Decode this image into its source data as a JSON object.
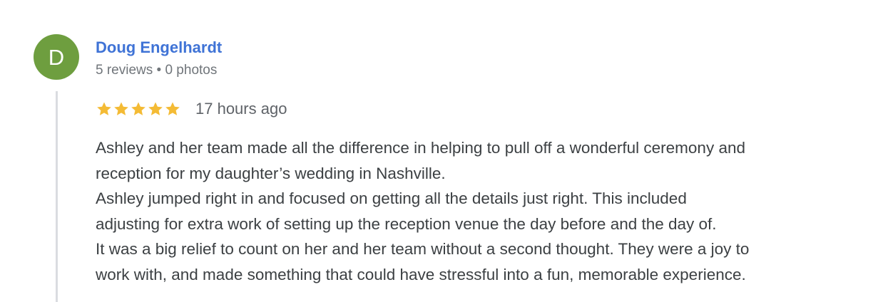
{
  "reviewer": {
    "initial": "D",
    "name": "Doug Engelhardt",
    "meta": "5 reviews • 0 photos",
    "avatar_color": "#6e9e3f",
    "name_color": "#3f73d6"
  },
  "review": {
    "rating": 5,
    "max_rating": 5,
    "star_color": "#f4bb35",
    "time_ago": "17 hours ago",
    "lines": [
      "Ashley and her team made all the difference in helping to pull off a wonderful ceremony and",
      "reception for my daughter’s wedding in Nashville.",
      "Ashley jumped right in and focused on getting all the details just right. This included",
      "adjusting for extra work of setting up the reception venue the day before and the day of.",
      "It was a big relief to count on her and her team without a second thought. They were a joy to",
      "work with, and made something that could have stressful into a fun, memorable experience."
    ]
  }
}
